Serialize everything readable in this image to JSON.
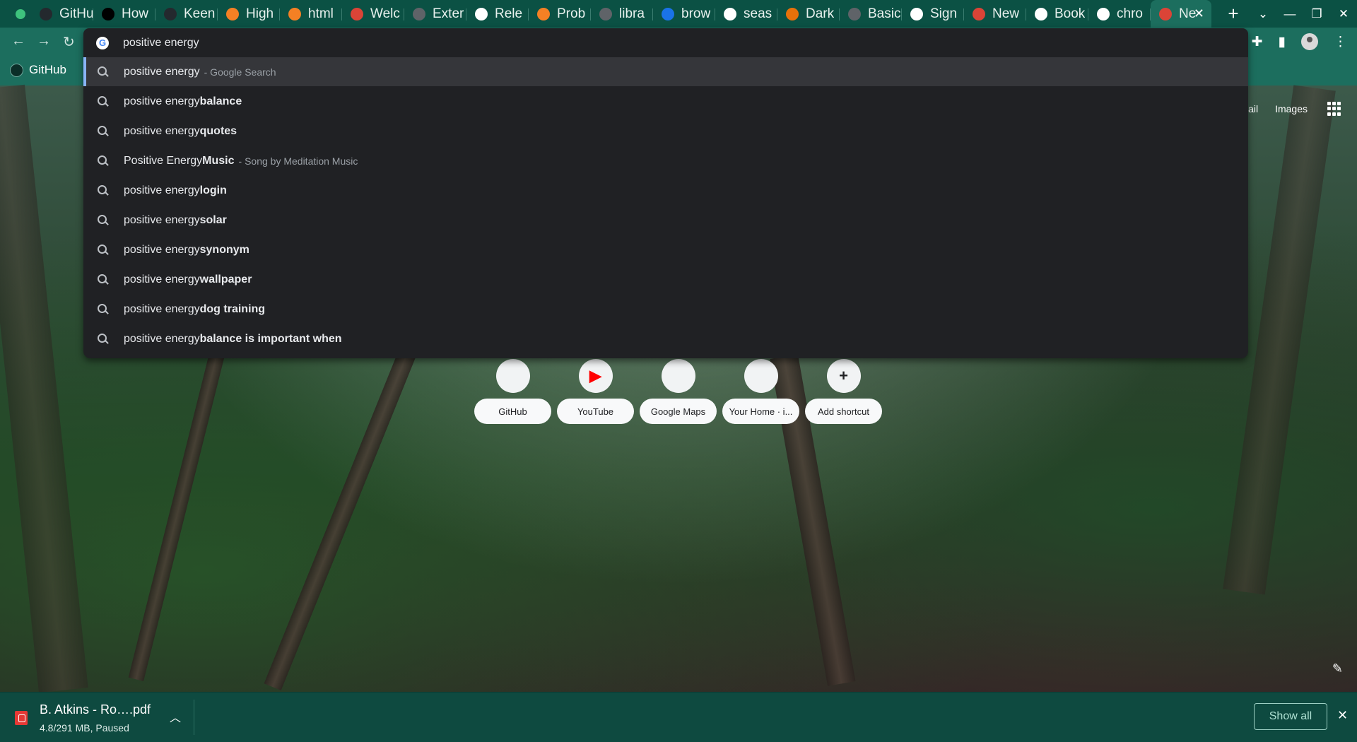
{
  "tabs": [
    {
      "title": "GitHub",
      "icon": "github-icon",
      "color": "#24292e"
    },
    {
      "title": "How",
      "icon": "medium-icon",
      "color": "#000000"
    },
    {
      "title": "Keen",
      "icon": "github-icon",
      "color": "#24292e"
    },
    {
      "title": "High",
      "icon": "stackoverflow-icon",
      "color": "#f48024"
    },
    {
      "title": "html",
      "icon": "stackoverflow-icon",
      "color": "#f48024"
    },
    {
      "title": "Welc",
      "icon": "chrome-icon",
      "color": "#db4437"
    },
    {
      "title": "Exter",
      "icon": "puzzle-icon",
      "color": "#5f6368"
    },
    {
      "title": "Rele",
      "icon": "wikipedia-icon",
      "color": "#ffffff"
    },
    {
      "title": "Prob",
      "icon": "stackoverflow-icon",
      "color": "#f48024"
    },
    {
      "title": "libra",
      "icon": "globe-icon",
      "color": "#5f6368"
    },
    {
      "title": "brow",
      "icon": "circle-icon",
      "color": "#1a73e8"
    },
    {
      "title": "seas",
      "icon": "google-icon",
      "color": "#ffffff"
    },
    {
      "title": "Dark",
      "icon": "palette-icon",
      "color": "#e8710a"
    },
    {
      "title": "Basic",
      "icon": "document-icon",
      "color": "#5f6368"
    },
    {
      "title": "Sign",
      "icon": "google-icon",
      "color": "#ffffff"
    },
    {
      "title": "New",
      "icon": "chrome-icon",
      "color": "#db4437"
    },
    {
      "title": "Book",
      "icon": "star-icon",
      "color": "#ffffff"
    },
    {
      "title": "chro",
      "icon": "google-icon",
      "color": "#ffffff"
    },
    {
      "title": "Ne",
      "icon": "chrome-icon",
      "color": "#db4437",
      "active": true
    }
  ],
  "bookmarks": [
    {
      "label": "GitHub"
    }
  ],
  "omnibox": {
    "query": "positive energy",
    "suggestions": [
      {
        "base": "positive energy",
        "bold": "",
        "sub": "- Google Search",
        "selected": true
      },
      {
        "base": "positive energy ",
        "bold": "balance",
        "sub": ""
      },
      {
        "base": "positive energy ",
        "bold": "quotes",
        "sub": ""
      },
      {
        "base": "Positive Energy ",
        "bold": "Music",
        "sub": "- Song by Meditation Music"
      },
      {
        "base": "positive energy ",
        "bold": "login",
        "sub": ""
      },
      {
        "base": "positive energy ",
        "bold": "solar",
        "sub": ""
      },
      {
        "base": "positive energy ",
        "bold": "synonym",
        "sub": ""
      },
      {
        "base": "positive energy ",
        "bold": "wallpaper",
        "sub": ""
      },
      {
        "base": "positive energy ",
        "bold": "dog training",
        "sub": ""
      },
      {
        "base": "positive energy ",
        "bold": "balance is important when",
        "sub": ""
      }
    ]
  },
  "header_links": {
    "gmail": "mail",
    "images": "Images"
  },
  "shortcuts": [
    {
      "label": "GitHub",
      "icon": "github-icon",
      "glyph": "",
      "color": "#202124"
    },
    {
      "label": "YouTube",
      "icon": "youtube-icon",
      "glyph": "▶",
      "color": "#ff0000"
    },
    {
      "label": "Google Maps",
      "icon": "maps-pin-icon",
      "glyph": "",
      "color": "#34a853"
    },
    {
      "label": "Your Home · i...",
      "icon": "bird-icon",
      "glyph": "",
      "color": "#7cb342"
    },
    {
      "label": "Add shortcut",
      "icon": "plus-icon",
      "glyph": "+",
      "color": "#202124"
    }
  ],
  "download": {
    "filename": "B. Atkins - Ro….pdf",
    "status": "4.8/291 MB, Paused",
    "show_all": "Show all"
  },
  "colors": {
    "tabstrip": "#0b5144",
    "toolbar": "#1c6e5e",
    "omnibox_bg": "#202124",
    "selected_row": "#35363a",
    "accent": "#8ab4f8"
  }
}
